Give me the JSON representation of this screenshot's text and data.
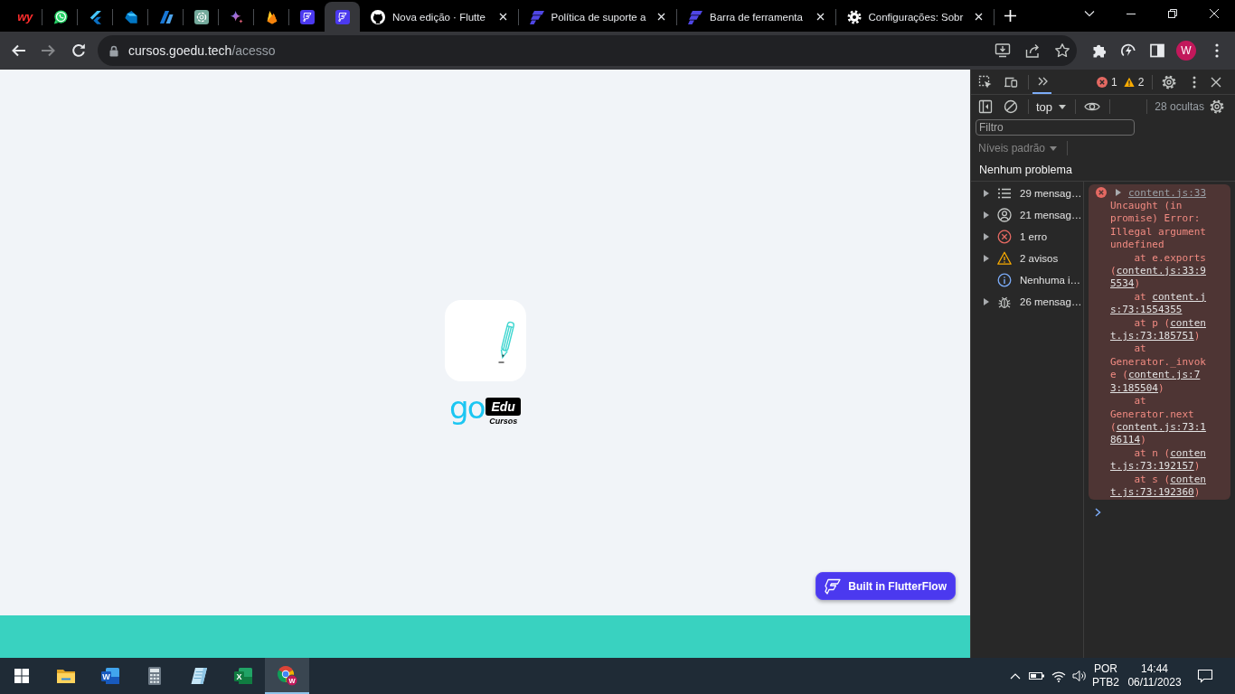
{
  "browser": {
    "pinned_tabs": [
      {
        "kind": "letters",
        "label": "wy",
        "selected": false
      },
      {
        "kind": "chat",
        "selected": false
      },
      {
        "kind": "chevrons",
        "selected": false
      },
      {
        "kind": "drop",
        "selected": false
      },
      {
        "kind": "bolt",
        "selected": false
      },
      {
        "kind": "knot",
        "selected": false
      },
      {
        "kind": "sparkle",
        "selected": false
      },
      {
        "kind": "flame",
        "selected": false
      },
      {
        "kind": "square",
        "selected": false
      },
      {
        "kind": "square",
        "selected": true
      }
    ],
    "tabs": [
      {
        "kind": "cat",
        "title": "Nova edição · Flutte",
        "selected": false
      },
      {
        "kind": "slant",
        "title": "Política de suporte a",
        "selected": false
      },
      {
        "kind": "slant",
        "title": "Barra de ferramenta",
        "selected": false
      },
      {
        "kind": "gear",
        "title": "Configurações: Sobr",
        "selected": false
      }
    ],
    "address": {
      "host": "cursos.goedu.tech",
      "path": "/acesso"
    },
    "avatar": "W"
  },
  "page": {
    "logo": {
      "word": "go",
      "tag": "Edu",
      "subtitle": "Cursos"
    },
    "badge_button": "Built in FlutterFlow"
  },
  "devtools": {
    "panel_tabs": [
      {
        "kind": "more",
        "selected": true
      }
    ],
    "errors": "1",
    "warnings": "2",
    "context": "top",
    "hidden": "28 ocultas",
    "filter": {
      "placeholder": "Filtro"
    },
    "levels": {
      "label": "Níveis padrão",
      "disabled": true
    },
    "issues": "Nenhum problema",
    "sidebar": [
      {
        "kind": "list",
        "label": "29 mensag…",
        "expandable": true,
        "selected": false
      },
      {
        "kind": "user",
        "label": "21 mensag…",
        "expandable": true,
        "selected": false
      },
      {
        "kind": "error",
        "label": "1 erro",
        "expandable": true,
        "selected": false
      },
      {
        "kind": "warning",
        "label": "2 avisos",
        "expandable": true,
        "selected": false
      },
      {
        "kind": "info",
        "label": "Nenhuma i…",
        "expandable": false,
        "selected": false
      },
      {
        "kind": "bug",
        "label": "26 mensag…",
        "expandable": true,
        "selected": false
      }
    ],
    "message": {
      "source": "content.js:33",
      "lines": [
        {
          "pre": "Uncaught (in"
        },
        {
          "pre": "promise) Error:"
        },
        {
          "pre": "Illegal argument"
        },
        {
          "pre": "undefined"
        },
        {
          "pre": "    at e.exports"
        },
        {
          "pre": "(",
          "link": "content.js:33:9"
        },
        {
          "link": "5534",
          "post": ")"
        },
        {
          "pre": "    at ",
          "link": "content.j"
        },
        {
          "link": "s:73:1554355"
        },
        {
          "pre": "    at p (",
          "link": "conten"
        },
        {
          "link": "t.js:73:185751",
          "post": ")"
        },
        {
          "pre": "    at"
        },
        {
          "pre": "Generator._invok"
        },
        {
          "pre": "e (",
          "link": "content.js:7"
        },
        {
          "link": "3:185504",
          "post": ")"
        },
        {
          "pre": "    at"
        },
        {
          "pre": "Generator.next"
        },
        {
          "pre": "(",
          "link": "content.js:73:1"
        },
        {
          "link": "86114",
          "post": ")"
        },
        {
          "pre": "    at n (",
          "link": "conten"
        },
        {
          "link": "t.js:73:192157",
          "post": ")"
        },
        {
          "pre": "    at s (",
          "link": "conten"
        },
        {
          "link": "t.js:73:192360",
          "post": ")"
        }
      ]
    }
  },
  "taskbar": {
    "apps": [
      {
        "kind": "folder",
        "active": false
      },
      {
        "kind": "word",
        "label": "W",
        "active": false
      },
      {
        "kind": "calculator",
        "active": false
      },
      {
        "kind": "notepad",
        "active": false
      },
      {
        "kind": "excel",
        "label": "X",
        "active": false
      },
      {
        "kind": "browser",
        "label": "W",
        "active": true
      }
    ],
    "language": "POR",
    "layout": "PTB2",
    "time": "14:44",
    "date": "06/11/2023"
  }
}
